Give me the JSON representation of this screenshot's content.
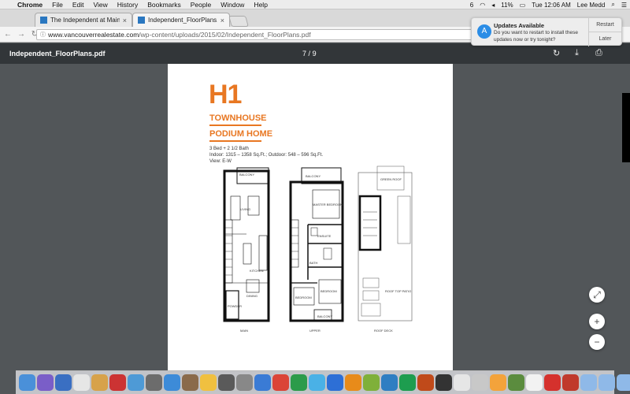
{
  "menubar": {
    "app": "Chrome",
    "items": [
      "File",
      "Edit",
      "View",
      "History",
      "Bookmarks",
      "People",
      "Window",
      "Help"
    ],
    "battery": "11%",
    "clock": "Tue 12:06 AM",
    "user": "Lee Medd",
    "badge": "6"
  },
  "tabs": [
    {
      "label": "The Independent at Main - Van"
    },
    {
      "label": "Independent_FloorPlans.pdf"
    }
  ],
  "address": {
    "host": "www.vancouverrealestate.com",
    "path": "/wp-content/uploads/2015/02/Independent_FloorPlans.pdf"
  },
  "pdf": {
    "filename": "Independent_FloorPlans.pdf",
    "page_current": "7",
    "page_sep": "/",
    "page_total": "9"
  },
  "plan": {
    "code": "H1",
    "title1": "TOWNHOUSE",
    "title2": "PODIUM HOME",
    "line1": "3 Bed + 2 1/2 Bath",
    "line2": "Indoor: 1315 – 1358 Sq.Ft.; Outdoor: 548 – 596 Sq.Ft.",
    "line3": "View: E-W",
    "labels": {
      "main": "MAIN",
      "upper": "UPPER",
      "roof": "ROOF DECK",
      "balcony": "BALCONY",
      "living": "LIVING",
      "kitchen": "KITCHEN",
      "dining": "DINING",
      "powder": "POWDER",
      "master": "MASTER BEDROOM",
      "ensuite": "ENSUITE",
      "bath": "BATH",
      "bedroom": "BEDROOM",
      "green_roof": "GREEN ROOF",
      "roof_patio": "ROOF TOP PATIO"
    }
  },
  "notification": {
    "title": "Updates Available",
    "body": "Do you want to restart to install these updates now or try tonight?",
    "restart": "Restart",
    "later": "Later"
  },
  "zoom": {
    "fit": "⤢",
    "in": "+",
    "out": "−"
  },
  "colors": {
    "accent": "#e87722",
    "toolbar": "#323639",
    "viewer_bg": "#525659"
  }
}
